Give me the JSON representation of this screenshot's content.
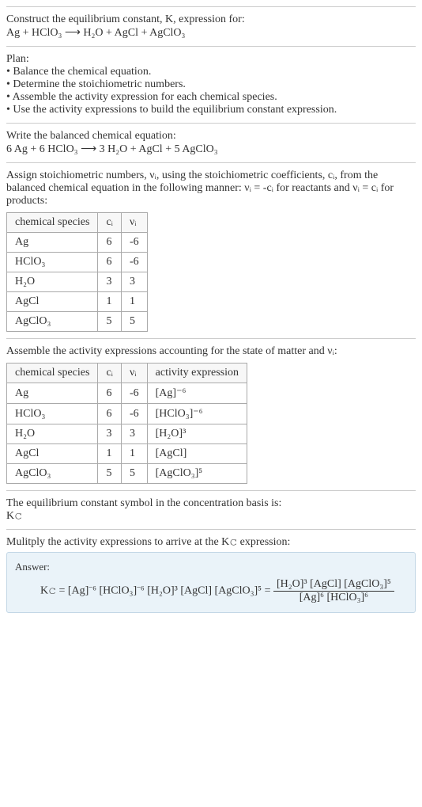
{
  "intro": {
    "title": "Construct the equilibrium constant, K, expression for:",
    "equation": "Ag + HClO₃  ⟶  H₂O + AgCl + AgClO₃"
  },
  "plan": {
    "title": "Plan:",
    "items": [
      "• Balance the chemical equation.",
      "• Determine the stoichiometric numbers.",
      "• Assemble the activity expression for each chemical species.",
      "• Use the activity expressions to build the equilibrium constant expression."
    ]
  },
  "balanced": {
    "title": "Write the balanced chemical equation:",
    "equation": "6 Ag + 6 HClO₃  ⟶  3 H₂O + AgCl + 5 AgClO₃"
  },
  "stoich": {
    "intro": "Assign stoichiometric numbers, νᵢ, using the stoichiometric coefficients, cᵢ, from the balanced chemical equation in the following manner: νᵢ = -cᵢ for reactants and νᵢ = cᵢ for products:",
    "headers": [
      "chemical species",
      "cᵢ",
      "νᵢ"
    ],
    "rows": [
      [
        "Ag",
        "6",
        "-6"
      ],
      [
        "HClO₃",
        "6",
        "-6"
      ],
      [
        "H₂O",
        "3",
        "3"
      ],
      [
        "AgCl",
        "1",
        "1"
      ],
      [
        "AgClO₃",
        "5",
        "5"
      ]
    ]
  },
  "activity": {
    "intro": "Assemble the activity expressions accounting for the state of matter and νᵢ:",
    "headers": [
      "chemical species",
      "cᵢ",
      "νᵢ",
      "activity expression"
    ],
    "rows": [
      {
        "sp": "Ag",
        "c": "6",
        "v": "-6",
        "expr": "[Ag]⁻⁶"
      },
      {
        "sp": "HClO₃",
        "c": "6",
        "v": "-6",
        "expr": "[HClO₃]⁻⁶"
      },
      {
        "sp": "H₂O",
        "c": "3",
        "v": "3",
        "expr": "[H₂O]³"
      },
      {
        "sp": "AgCl",
        "c": "1",
        "v": "1",
        "expr": "[AgCl]"
      },
      {
        "sp": "AgClO₃",
        "c": "5",
        "v": "5",
        "expr": "[AgClO₃]⁵"
      }
    ]
  },
  "symbol": {
    "line1": "The equilibrium constant symbol in the concentration basis is:",
    "line2": "K𝚌"
  },
  "final": {
    "intro": "Mulitply the activity expressions to arrive at the K𝚌 expression:",
    "answerLabel": "Answer:",
    "lhs": "K𝚌 = [Ag]⁻⁶ [HClO₃]⁻⁶ [H₂O]³ [AgCl] [AgClO₃]⁵ =",
    "num": "[H₂O]³ [AgCl] [AgClO₃]⁵",
    "den": "[Ag]⁶ [HClO₃]⁶"
  },
  "chart_data": {
    "type": "table",
    "title": "Stoichiometric numbers",
    "columns": [
      "chemical species",
      "cᵢ",
      "νᵢ"
    ],
    "rows": [
      [
        "Ag",
        6,
        -6
      ],
      [
        "HClO₃",
        6,
        -6
      ],
      [
        "H₂O",
        3,
        3
      ],
      [
        "AgCl",
        1,
        1
      ],
      [
        "AgClO₃",
        5,
        5
      ]
    ]
  }
}
